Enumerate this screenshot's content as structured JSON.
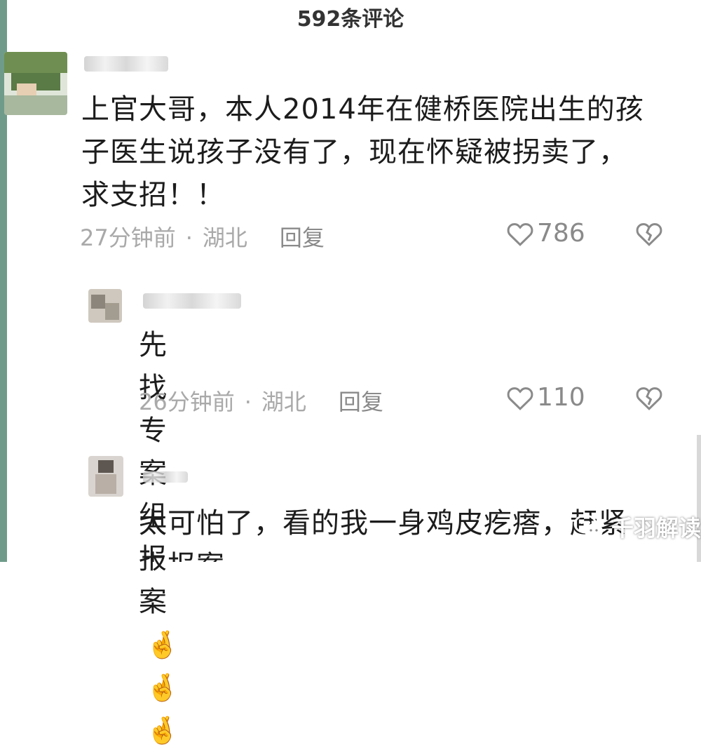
{
  "header": {
    "comment_count_title": "592条评论"
  },
  "comments": [
    {
      "text_lines": [
        "上官大哥，本人2014年在健桥医院出生的孩",
        "子医生说孩子没有了，现在怀疑被拐卖了，",
        "求支招！！"
      ],
      "time": "27分钟前",
      "location": "湖北",
      "reply_label": "回复",
      "likes": "786"
    },
    {
      "text": "先找专案组报案",
      "emoji": "🤞",
      "time": "26分钟前",
      "location": "湖北",
      "reply_label": "回复",
      "likes": "110"
    },
    {
      "text_lines": [
        "太可怕了，看的我一身鸡皮疙瘩，赶紧",
        "去报案"
      ]
    }
  ],
  "watermark": {
    "text": "千羽解读",
    "icon": "wechat-icon"
  },
  "colors": {
    "meta_text": "#a9a9a9",
    "body_text": "#1c1c1c",
    "left_edge": "#6f9c8a"
  }
}
